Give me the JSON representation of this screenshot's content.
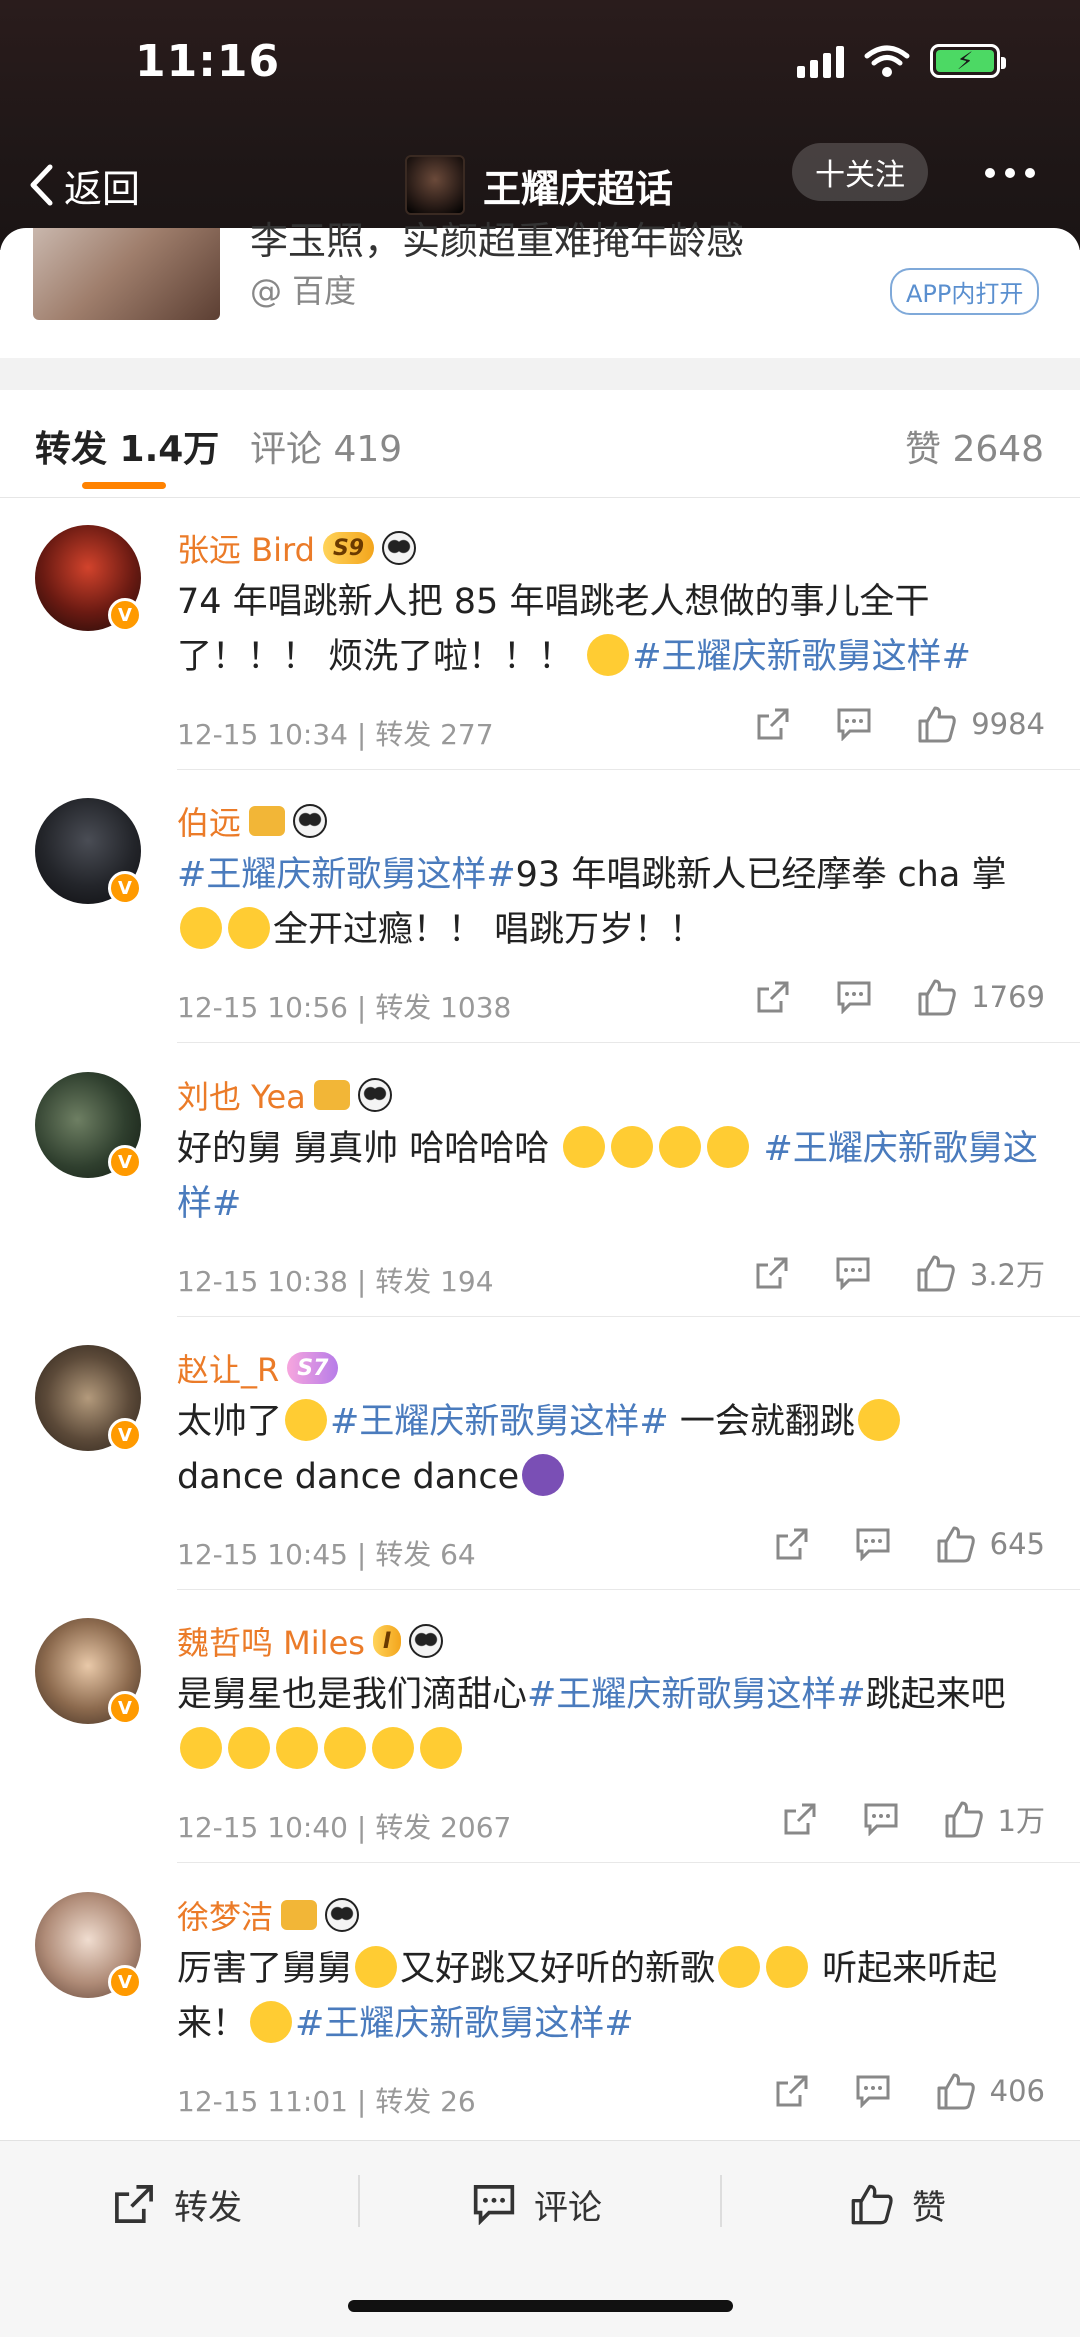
{
  "status": {
    "time": "11:16"
  },
  "nav": {
    "back_label": "返回",
    "title": "王耀庆超话",
    "follow_label": "十关注"
  },
  "article": {
    "title_partial": "李玉照，实颜超重难掩年龄感",
    "source": "@ 百度",
    "app_open": "APP内打开"
  },
  "tabs": {
    "repost": "转发 1.4万",
    "comments": "评论 419",
    "likes": "赞 2648"
  },
  "comments": [
    {
      "name": "张远 Bird",
      "level": "S9",
      "text_a": "74 年唱跳新人把 85 年唱跳老人想做的事儿全干了！！！ 烦洗了啦！！！",
      "hashtag_a": "#王耀庆新歌舅这样#",
      "text_b": "",
      "hashtag_b": "",
      "text_c": "",
      "meta": "12-15 10:34 | 转发 277",
      "likes": "9984"
    },
    {
      "name": "伯远",
      "level": "",
      "text_a": "",
      "hashtag_a": "#王耀庆新歌舅这样#",
      "text_b": "93 年唱跳新人已经摩拳 cha 掌",
      "hashtag_b": "",
      "text_c": "全开过瘾！！ 唱跳万岁！！",
      "meta": "12-15 10:56 | 转发 1038",
      "likes": "1769"
    },
    {
      "name": "刘也 Yea",
      "level": "",
      "text_a": "好的舅 舅真帅 哈哈哈哈",
      "hashtag_a": "#王耀庆新歌舅这样#",
      "text_b": "",
      "hashtag_b": "",
      "text_c": "",
      "meta": "12-15 10:38 | 转发 194",
      "likes": "3.2万"
    },
    {
      "name": "赵让_R",
      "level": "S7",
      "text_a": "太帅了",
      "hashtag_a": "#王耀庆新歌舅这样#",
      "text_b": "一会就翻跳",
      "hashtag_b": "",
      "text_c": "dance dance dance",
      "meta": "12-15 10:45 | 转发 64",
      "likes": "645"
    },
    {
      "name": "魏哲鸣 Miles",
      "level": "I",
      "text_a": "是舅星也是我们滴甜心",
      "hashtag_a": "#王耀庆新歌舅这样#",
      "text_b": "跳起来吧",
      "hashtag_b": "",
      "text_c": "",
      "meta": "12-15 10:40 | 转发 2067",
      "likes": "1万"
    },
    {
      "name": "徐梦洁",
      "level": "",
      "text_a": "厉害了舅舅",
      "hashtag_a": "",
      "text_b": "又好跳又好听的新歌",
      "hashtag_b": "#王耀庆新歌舅这样#",
      "text_c": "听起来听起来！",
      "meta": "12-15 11:01 | 转发 26",
      "likes": "406"
    }
  ],
  "bottombar": {
    "repost": "转发",
    "comment": "评论",
    "like": "赞"
  },
  "colors": {
    "accent": "#ff8200",
    "hashtag": "#4a7bbd",
    "username": "#eb7b28"
  }
}
